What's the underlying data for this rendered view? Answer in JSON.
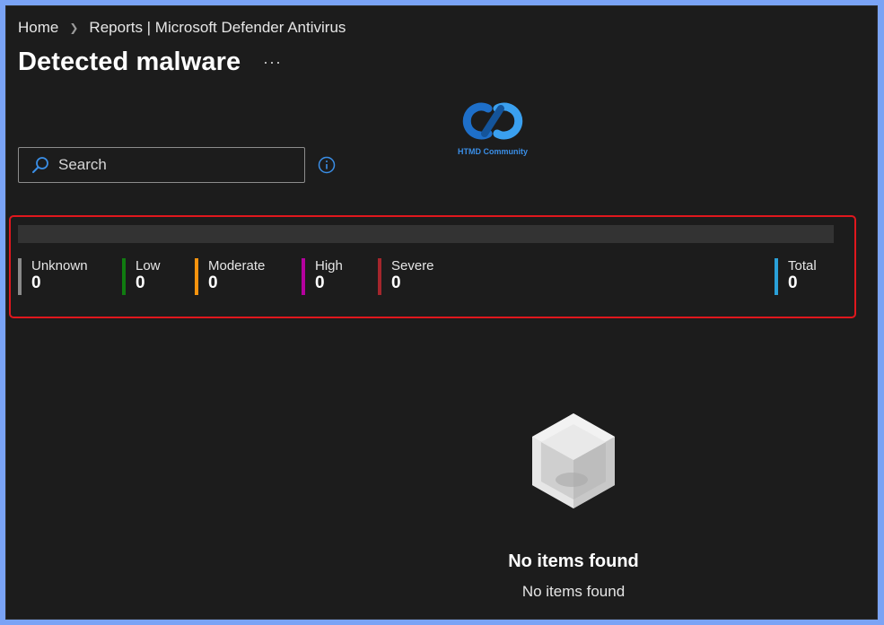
{
  "breadcrumb": {
    "home": "Home",
    "current": "Reports | Microsoft Defender Antivirus"
  },
  "header": {
    "title": "Detected malware",
    "more_label": "···"
  },
  "watermark": {
    "text": "HTMD Community"
  },
  "search": {
    "placeholder": "Search",
    "value": ""
  },
  "summary": {
    "severities": [
      {
        "label": "Unknown",
        "count": "0",
        "color": "#8a8a8a"
      },
      {
        "label": "Low",
        "count": "0",
        "color": "#107c10"
      },
      {
        "label": "Moderate",
        "count": "0",
        "color": "#f7930e"
      },
      {
        "label": "High",
        "count": "0",
        "color": "#b4009e"
      },
      {
        "label": "Severe",
        "count": "0",
        "color": "#a4262c"
      }
    ],
    "total": {
      "label": "Total",
      "count": "0",
      "color": "#2aa0d8"
    }
  },
  "empty_state": {
    "title": "No items found",
    "subtitle": "No items found"
  },
  "colors": {
    "background": "#1c1c1c",
    "accent": "#3a8ee6",
    "highlight": "#e0171d"
  },
  "icons": {
    "breadcrumb_separator": "chevron-right-icon",
    "search": "search-icon",
    "info": "info-icon",
    "empty": "empty-box-icon"
  }
}
